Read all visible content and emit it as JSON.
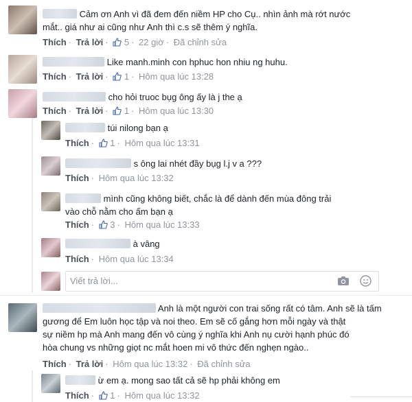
{
  "comments": [
    {
      "text_line1": "Cảm ơn Anh vì đã đem đến niềm HP cho Cụ.. nhìn ảnh mà rớt nước",
      "text_line2": "mắt.. giá như ai cũng như Anh thì c.s sẽ thêm ý nghĩa.",
      "like": "Thích",
      "reply": "Trả lời",
      "likes": "5",
      "time": "22 giờ",
      "edited": "Đã chỉnh sửa"
    },
    {
      "text_line1": "Like manh.minh con hphuc hon nhiu ng huhu.",
      "like": "Thích",
      "reply": "Trả lời",
      "likes": "1",
      "time": "Hôm qua lúc 13:28"
    },
    {
      "text_line1": "cho hỏi truoc bụg ông ấy là j the ạ",
      "like": "Thích",
      "reply": "Trả lời",
      "likes": "1",
      "time": "Hôm qua lúc 13:30",
      "replies": [
        {
          "text_line1": "túi nilong bạn ạ",
          "like": "Thích",
          "likes": "1",
          "time": "Hôm qua lúc 13:31"
        },
        {
          "text_line1": "s ông lai nhét đầy bụg l.j v a ???",
          "like": "Thích",
          "time": "Hôm qua lúc 13:32"
        },
        {
          "text_line1": "mình cũng không biết, chắc là để dành đến mùa đông trải",
          "text_line2": "vào chỗ nằm cho ấm bạn ạ",
          "like": "Thích",
          "likes": "3",
          "time": "Hôm qua lúc 13:33"
        },
        {
          "text_line1": "à vâng",
          "like": "Thích",
          "time": "Hôm qua lúc 13:34"
        }
      ],
      "reply_placeholder": "Viết trả lời..."
    },
    {
      "text_line1": "Anh là một người con trai sống rất có tâm. Anh sẽ là tấm",
      "text_line2": "gương để Em luôn học tập và noi theo. Em sẽ cố gắng hơn mỗi ngày và thật",
      "text_line3": "sự niềm hp mà Anh mang đến vô cùng ý nghĩa khi Anh nụ cười hạnh phúc đó",
      "text_line4": "hòa chung vs những giọt nc mắt hoen mi vô thức đến nghẹn ngào..",
      "like": "Thích",
      "reply": "Trả lời",
      "time": "Hôm qua lúc 13:32",
      "edited": "Đã chỉnh sửa",
      "replies": [
        {
          "text_line1": "ừ em ạ. mong sao tất cả sẽ hp phải không em",
          "like": "Thích",
          "likes": "1",
          "time": "Hôm qua lúc 13:32"
        }
      ]
    }
  ],
  "colors": {
    "link": "#4b4f56",
    "meta": "#90949c",
    "like_blue": "#4267b2"
  }
}
